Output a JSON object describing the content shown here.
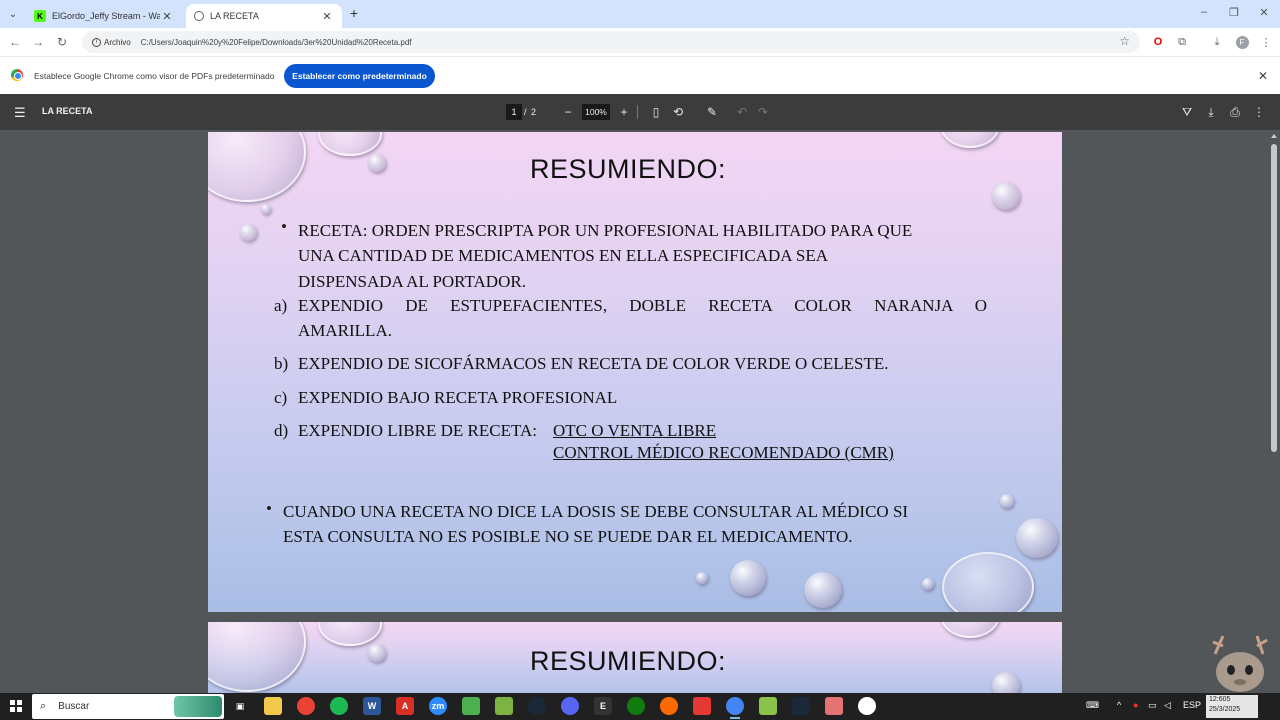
{
  "browser": {
    "tabs": [
      {
        "title": "ElGordo_Jeffy Stream - Watch L",
        "favicon": "kick-icon",
        "active": false
      },
      {
        "title": "LA RECETA",
        "favicon": "globe-icon",
        "active": true
      }
    ],
    "new_tab_label": "+",
    "address": {
      "chip_label": "Archivo",
      "url": "C:/Users/Joaquin%20y%20Felipe/Downloads/3er%20Unidad%20Receta.pdf"
    }
  },
  "infobar": {
    "message": "Establece Google Chrome como visor de PDFs predeterminado",
    "button_label": "Establecer como predeterminado"
  },
  "pdf_toolbar": {
    "title": "LA RECETA",
    "page_current": "1",
    "page_separator": "/",
    "page_total": "2",
    "zoom": "100%"
  },
  "slide1": {
    "title": "RESUMIENDO:",
    "bullet1": {
      "marker": "•",
      "lines": [
        "RECETA: ORDEN PRESCRIPTA POR UN PROFESIONAL HABILITADO PARA QUE",
        "UNA CANTIDAD DE MEDICAMENTOS EN ELLA ESPECIFICADA SEA",
        "DISPENSADA AL PORTADOR."
      ]
    },
    "items": [
      {
        "marker": "a)",
        "lines": [
          "EXPENDIO DE ESTUPEFACIENTES, DOBLE RECETA COLOR NARANJA O",
          "AMARILLA."
        ]
      },
      {
        "marker": "b)",
        "text": "EXPENDIO DE SICOFÁRMACOS EN RECETA DE COLOR VERDE O CELESTE."
      },
      {
        "marker": "c)",
        "text": "EXPENDIO BAJO RECETA PROFESIONAL"
      },
      {
        "marker": "d)",
        "prefix": "EXPENDIO LIBRE DE RECETA: ",
        "option1": "OTC O VENTA LIBRE",
        "option2": "CONTROL MÉDICO RECOMENDADO (CMR)"
      }
    ],
    "bullet2": {
      "marker": "•",
      "lines": [
        "CUANDO  UNA RECETA NO DICE LA DOSIS SE DEBE CONSULTAR AL MÉDICO SI",
        "ESTA CONSULTA NO ES POSIBLE NO SE PUEDE DAR EL MEDICAMENTO."
      ]
    }
  },
  "slide2": {
    "title": "RESUMIENDO:"
  },
  "taskbar": {
    "search_placeholder": "Buscar",
    "language": "ESP",
    "time": "12:605",
    "date": "25/3/2025"
  }
}
